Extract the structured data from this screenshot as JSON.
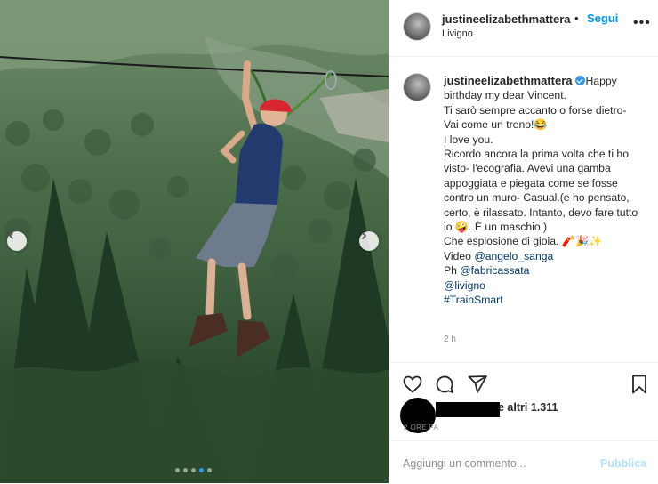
{
  "post": {
    "username": "justineelizabethmattera",
    "separator": "•",
    "follow_label": "Segui",
    "location": "Livigno",
    "more_label": "•••",
    "carousel": {
      "dot_count": 5,
      "active_index": 3
    }
  },
  "caption": {
    "username": "justineelizabethmattera",
    "text_1": "Happy birthday my dear Vincent.\nTi sarò sempre accanto o forse dietro- Vai come un treno!😂\nI love you.\nRicordo ancora la prima volta che ti ho visto- l'ecografia. Avevi una gamba appoggiata e piegata come se fosse contro un muro- Casual.(e ho pensato, certo, è rilassato. Intanto, devo fare tutto io 🤪. È un maschio.)\nChe esplosione di gioia. 🧨🎉✨\nVideo ",
    "link_1": "@angelo_sanga",
    "text_2": "\nPh ",
    "link_2": "@fabricassata",
    "text_3": "\n",
    "link_3": "@livigno",
    "text_4": "\n",
    "link_4": "#TrainSmart",
    "time": "2 h"
  },
  "likes": {
    "text": "e altri 1.311",
    "ago": "2 ORE FA"
  },
  "comment": {
    "placeholder": "Aggiungi un commento...",
    "publish_label": "Pubblica"
  },
  "colors": {
    "accent": "#0095f6",
    "link": "#00376b",
    "muted": "#8e8e8e",
    "publish_disabled": "#b2dffc",
    "helmet": "#d8262e"
  },
  "icons": [
    "chevron-left-icon",
    "chevron-right-icon",
    "more-icon",
    "verified-icon",
    "heart-icon",
    "comment-icon",
    "share-icon",
    "bookmark-icon"
  ]
}
